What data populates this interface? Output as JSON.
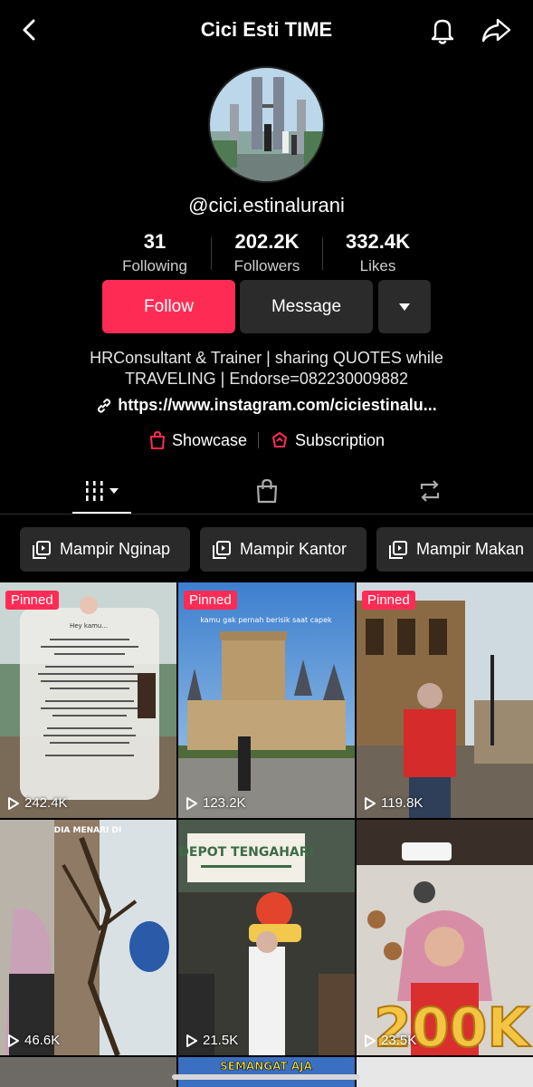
{
  "header": {
    "title": "Cici Esti TIME"
  },
  "profile": {
    "username": "@cici.estinalurani",
    "stats": [
      {
        "value": "31",
        "label": "Following"
      },
      {
        "value": "202.2K",
        "label": "Followers"
      },
      {
        "value": "332.4K",
        "label": "Likes"
      }
    ],
    "follow_label": "Follow",
    "message_label": "Message",
    "bio_line1": "HRConsultant & Trainer | sharing QUOTES while",
    "bio_line2": "TRAVELING | Endorse=082230009882",
    "link": "https://www.instagram.com/ciciestinalu...",
    "showcase_label": "Showcase",
    "subscription_label": "Subscription"
  },
  "playlists": [
    "Mampir Nginap",
    "Mampir Kantor",
    "Mampir Makan"
  ],
  "videos": [
    {
      "views": "242.4K",
      "pinned": "Pinned",
      "caption": "Hey kamu..."
    },
    {
      "views": "123.2K",
      "pinned": "Pinned",
      "caption": "kamu gak pernah berisik saat capek"
    },
    {
      "views": "119.8K",
      "pinned": "Pinned"
    },
    {
      "views": "46.6K",
      "caption": "DIA MENARI DI"
    },
    {
      "views": "21.5K",
      "caption": "DEPOT TENGAHARI"
    },
    {
      "views": "23.5K",
      "caption": "200K"
    },
    {
      "caption": "SEMANGAT AJA"
    }
  ],
  "colors": {
    "accent": "#fe2c55",
    "button_dark": "#2b2b2b",
    "background": "#000000"
  }
}
